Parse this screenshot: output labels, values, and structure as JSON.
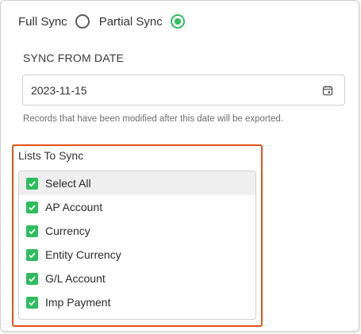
{
  "sync_mode": {
    "options": [
      {
        "label": "Full Sync",
        "selected": false
      },
      {
        "label": "Partial Sync",
        "selected": true
      }
    ],
    "accent_color": "#2dbd5e"
  },
  "sync_from": {
    "title": "SYNC FROM DATE",
    "value": "2023-11-15",
    "icon": "calendar-icon",
    "help": "Records that have been modified after this date will be exported."
  },
  "lists": {
    "title": "Lists To Sync",
    "highlight_color": "#e4521b",
    "items": [
      {
        "label": "Select All",
        "checked": true
      },
      {
        "label": "AP Account",
        "checked": true
      },
      {
        "label": "Currency",
        "checked": true
      },
      {
        "label": "Entity Currency",
        "checked": true
      },
      {
        "label": "G/L Account",
        "checked": true
      },
      {
        "label": "Imp Payment",
        "checked": true
      }
    ]
  }
}
